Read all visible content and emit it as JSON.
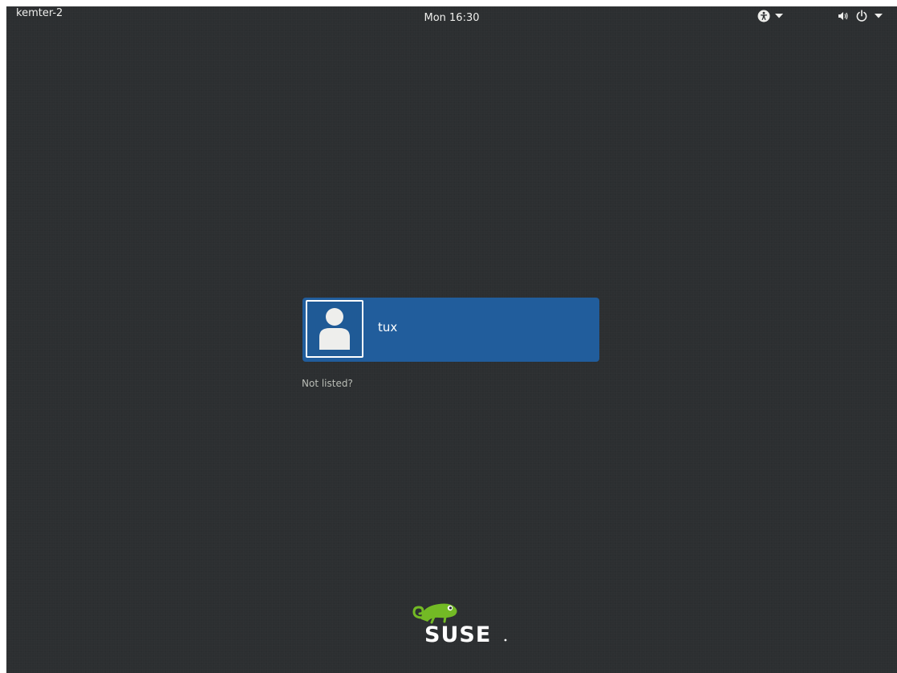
{
  "topbar": {
    "hostname": "kemter-2",
    "clock": "Mon 16:30",
    "accessibility_icon": "accessibility-icon",
    "volume_icon": "volume-icon",
    "power_icon": "power-icon"
  },
  "login": {
    "users": [
      {
        "name": "tux",
        "avatar_icon": "user-avatar-icon"
      }
    ],
    "not_listed_label": "Not listed?"
  },
  "branding": {
    "logo_text": "SUSE",
    "logo_icon": "suse-chameleon-logo"
  },
  "colors": {
    "background": "#2c2f31",
    "user_card": "#215d9c",
    "text": "#eeeeec",
    "logo_green": "#73ba25"
  }
}
